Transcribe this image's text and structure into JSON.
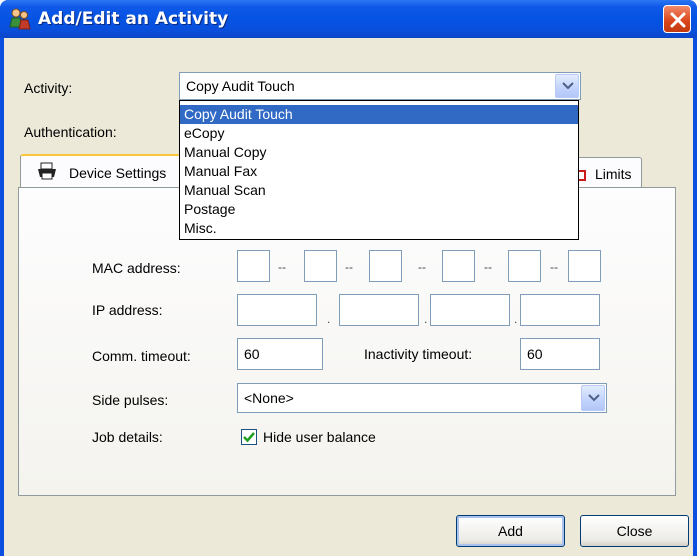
{
  "window": {
    "title": "Add/Edit an Activity"
  },
  "activity": {
    "label": "Activity:",
    "selected": "Copy Audit Touch",
    "options": [
      "Copy Audit Touch",
      "eCopy",
      "Manual Copy",
      "Manual Fax",
      "Manual Scan",
      "Postage",
      "Misc."
    ]
  },
  "authentication": {
    "label": "Authentication:"
  },
  "tabs": [
    {
      "label": "Device Settings",
      "active": true
    },
    {
      "label": "Limits",
      "active": false
    }
  ],
  "device": {
    "mac_label": "MAC address:",
    "mac_separator": "--",
    "ip_label": "IP address:",
    "ip_separator": ".",
    "comm_timeout_label": "Comm. timeout:",
    "comm_timeout_value": "60",
    "inactivity_timeout_label": "Inactivity timeout:",
    "inactivity_timeout_value": "60",
    "side_pulses_label": "Side pulses:",
    "side_pulses_value": "<None>",
    "job_details_label": "Job details:",
    "hide_user_balance_label": "Hide user balance",
    "hide_user_balance_checked": true
  },
  "buttons": {
    "add": "Add",
    "close": "Close"
  },
  "colors": {
    "titlebar": "#0553e3",
    "selection": "#316ac5",
    "dialog_bg": "#ece9d8",
    "close": "#d9441a"
  }
}
